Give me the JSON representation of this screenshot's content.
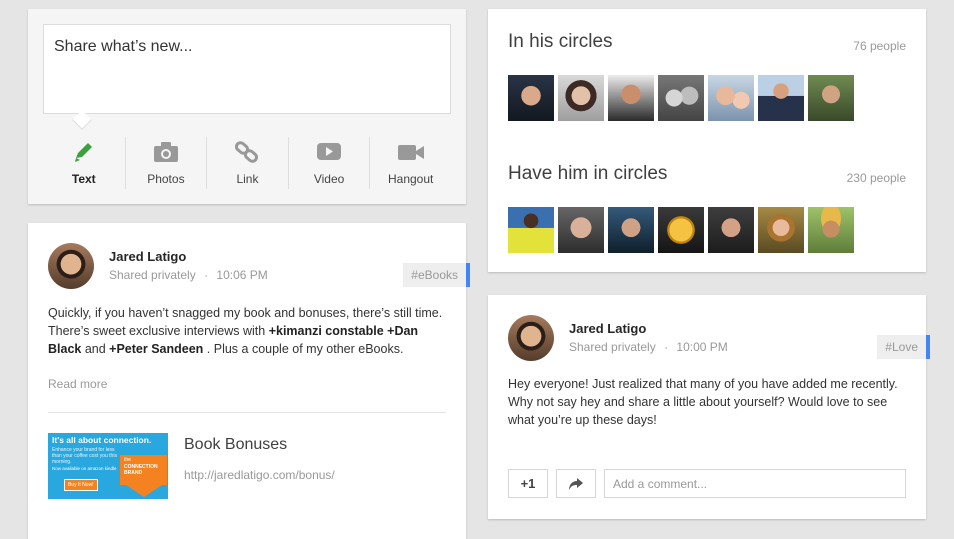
{
  "share": {
    "placeholder": "Share what’s new...",
    "actions": [
      {
        "label": "Text",
        "icon": "pencil-icon"
      },
      {
        "label": "Photos",
        "icon": "camera-icon"
      },
      {
        "label": "Link",
        "icon": "link-icon"
      },
      {
        "label": "Video",
        "icon": "video-play-icon"
      },
      {
        "label": "Hangout",
        "icon": "video-camera-icon"
      }
    ]
  },
  "circles": {
    "in_title": "In his circles",
    "in_count": "76 people",
    "have_title": "Have him in circles",
    "have_count": "230 people"
  },
  "post1": {
    "author": "Jared Latigo",
    "visibility": "Shared privately",
    "dot": "·",
    "time": "10:06 PM",
    "tag": "#eBooks",
    "text_1": "Quickly, if you haven’t snagged my book and bonuses, there’s still time. There’s sweet exclusive interviews with ",
    "mention_1": "+kimanzi constable",
    "text_2": " ",
    "mention_2": "+Dan Black",
    "text_3": " and ",
    "mention_3": "+Peter Sandeen",
    "text_4": " . Plus a couple of my other eBooks.",
    "read_more": "Read more",
    "link_title": "Book Bonuses",
    "link_url": "http://jaredlatigo.com/bonus/",
    "thumb_headline": "It's all about connection.",
    "thumb_sub": "Enhance your brand for less than your coffee cost you this morning.",
    "thumb_avail": "Now available on amazon kindle",
    "thumb_button": "Buy It Now!",
    "thumb_book_small": "the",
    "thumb_book": "CONNECTION BRAND"
  },
  "post2": {
    "author": "Jared Latigo",
    "visibility": "Shared privately",
    "dot": "·",
    "time": "10:00 PM",
    "tag": "#Love",
    "text": "Hey everyone! Just realized that many of you have added me recently. Why not say hey and share a little about yourself? Would love to see what you’re up these days!",
    "plus_one": "+1",
    "comment_placeholder": "Add a comment..."
  },
  "colors": {
    "accent": "#4285f4",
    "pencil_green": "#3c9f40",
    "background": "#e5e5e5"
  }
}
